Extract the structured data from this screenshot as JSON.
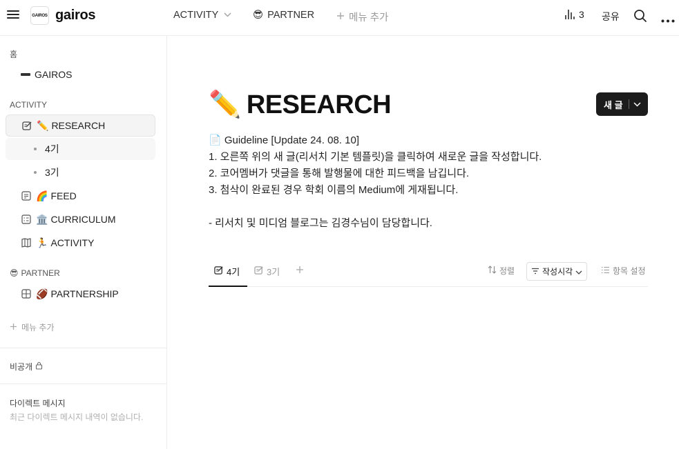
{
  "topbar": {
    "logo_mark": "GAIROS",
    "brand": "gairos",
    "nav": [
      {
        "label": "ACTIVITY",
        "emoji": ""
      },
      {
        "label": "PARTNER",
        "emoji": "😎"
      },
      {
        "label": "메뉴 추가",
        "emoji": ""
      }
    ],
    "view_count": "3",
    "share_label": "공유"
  },
  "sidebar": {
    "home_label": "홈",
    "home_item": "GAIROS",
    "activity_label": "ACTIVITY",
    "items": [
      {
        "emoji": "✏️",
        "label": "RESEARCH"
      },
      {
        "emoji": "🌈",
        "label": "FEED"
      },
      {
        "emoji": "🏛️",
        "label": "CURRICULUM"
      },
      {
        "emoji": "🏃",
        "label": "ACTIVITY"
      },
      {
        "emoji": "🏈",
        "label": "PARTNERSHIP"
      }
    ],
    "research_subs": [
      "4기",
      "3기"
    ],
    "partner_label": "PARTNER",
    "partner_emoji": "😎",
    "menu_add": "메뉴 추가",
    "private_label": "비공개",
    "dm_title": "다이렉트 메시지",
    "dm_empty": "최근 다이렉트 메시지 내역이 없습니다."
  },
  "main": {
    "title_emoji": "✏️",
    "title": "RESEARCH",
    "new_button": "새 글",
    "description": [
      "📄 Guideline [Update 24. 08. 10]",
      "1. 오른쪽 위의 새 글(리서치 기본 템플릿)을 클릭하여 새로운 글을 작성합니다.",
      "2. 코어멤버가 댓글을 통해 발행물에 대한 피드백을 남깁니다.",
      "3. 첨삭이 완료된 경우 학회 이름의 Medium에 게재됩니다.",
      "",
      "- 리서치 및 미디엄 블로그는 김경수님이 담당합니다."
    ],
    "tabs": [
      "4기",
      "3기"
    ],
    "sort_label": "정렬",
    "filter_label": "작성시각",
    "settings_label": "항목 설정"
  }
}
